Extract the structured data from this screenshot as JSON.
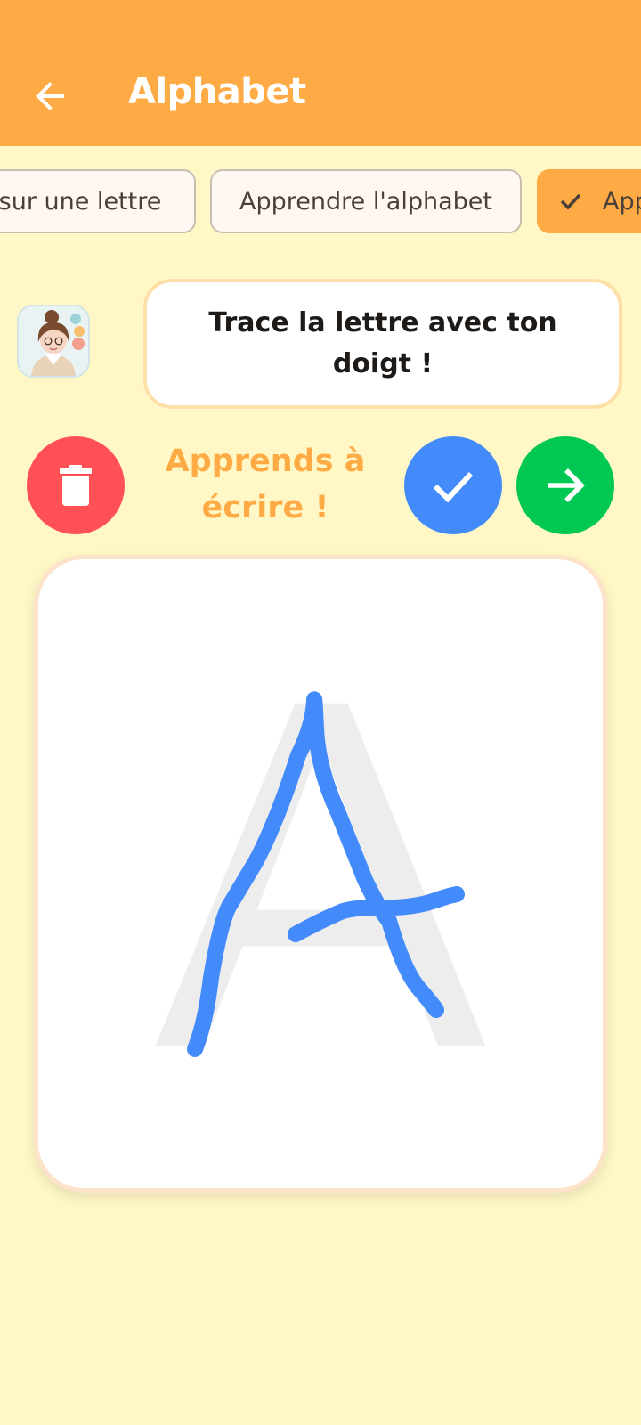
{
  "app_bar": {
    "title": "Alphabet"
  },
  "chips": [
    {
      "label": "sur une lettre",
      "selected": false
    },
    {
      "label": "Apprendre l'alphabet",
      "selected": false
    },
    {
      "label": "App",
      "selected": true
    }
  ],
  "instruction": {
    "text": "Trace la lettre avec ton doigt !"
  },
  "heading": {
    "line1": "Apprends à",
    "line2": "écrire !"
  },
  "tracing": {
    "guide_letter": "A"
  },
  "icons": {
    "back": "arrow-left-icon",
    "chip_check": "check-icon",
    "trash": "trash-icon",
    "validate": "check-icon",
    "next": "arrow-right-icon"
  },
  "colors": {
    "app_bar": "#FFAB45",
    "background": "#FFF8C6",
    "heading": "#FFAB45",
    "trash_button": "#FF5155",
    "check_button": "#438BFB",
    "next_button": "#00C853",
    "stroke": "#438BFB",
    "guide": "#EDEDED"
  }
}
